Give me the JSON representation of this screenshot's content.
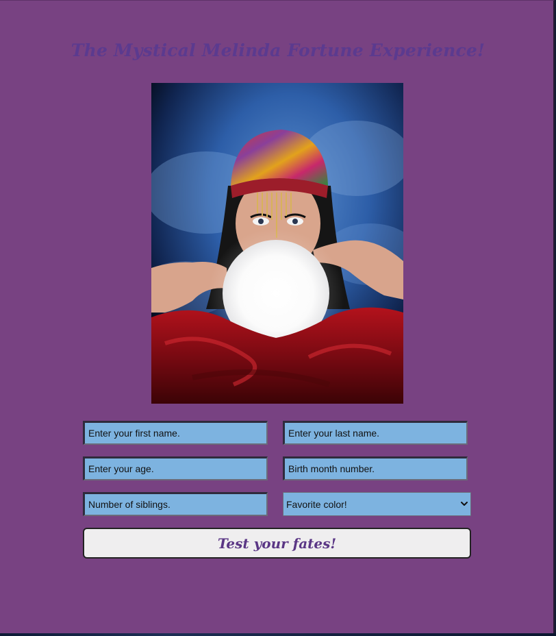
{
  "page": {
    "title": "The Mystical Melinda Fortune Experience!"
  },
  "hero_image": {
    "alt": "Fortune teller with a glowing crystal ball"
  },
  "form": {
    "first_name": {
      "placeholder": "Enter your first name.",
      "value": ""
    },
    "last_name": {
      "placeholder": "Enter your last name.",
      "value": ""
    },
    "age": {
      "placeholder": "Enter your age.",
      "value": ""
    },
    "birth_month": {
      "placeholder": "Birth month number.",
      "value": ""
    },
    "siblings": {
      "placeholder": "Number of siblings.",
      "value": ""
    },
    "favorite_color": {
      "selected": "Favorite color!"
    },
    "submit_label": "Test your fates!"
  },
  "colors": {
    "page_background": "#784282",
    "title_text": "#5b3a8f",
    "field_background": "#7db3e0",
    "button_background": "#efeeef",
    "button_text": "#5a3685"
  },
  "icons": {
    "select_arrow": "chevron-down-icon"
  }
}
